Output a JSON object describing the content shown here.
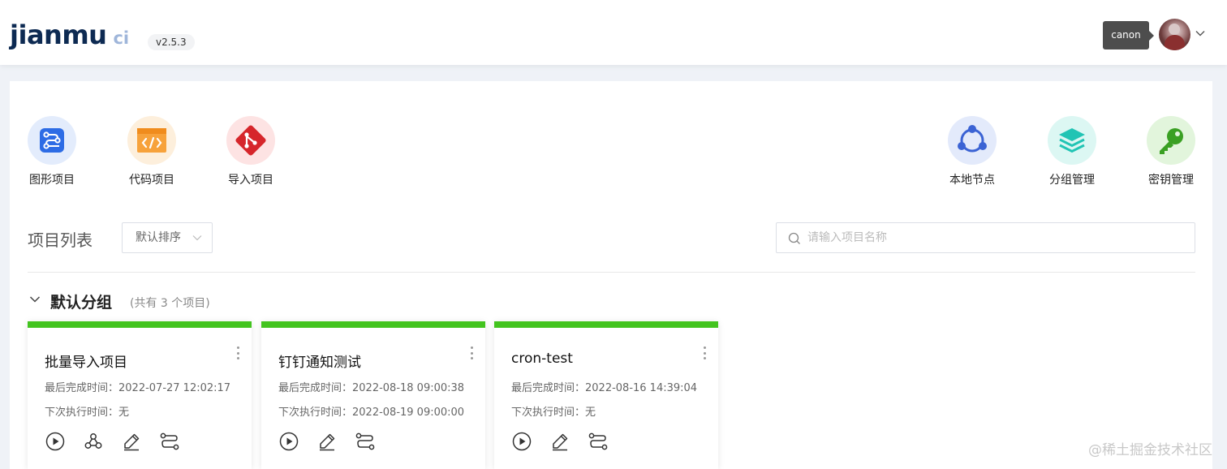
{
  "header": {
    "logo_main": "jianmu",
    "logo_ci": "ci",
    "version": "v2.5.3",
    "user_tooltip": "canon"
  },
  "quick_actions": [
    {
      "label": "图形项目",
      "icon": "graph-project-icon"
    },
    {
      "label": "代码项目",
      "icon": "code-project-icon"
    },
    {
      "label": "导入项目",
      "icon": "git-import-icon"
    },
    {
      "label": "本地节点",
      "icon": "local-node-icon"
    },
    {
      "label": "分组管理",
      "icon": "group-layers-icon"
    },
    {
      "label": "密钥管理",
      "icon": "key-icon"
    }
  ],
  "colors": {
    "accent_green": "#43c41f",
    "graph_blue": "#2d6ce5",
    "code_orange": "#f7a23b",
    "git_red": "#d6262b",
    "node_blue": "#3b63d4",
    "layers_teal": "#21c4b4",
    "key_green": "#3aa023"
  },
  "list": {
    "title": "项目列表",
    "sort_label": "默认排序",
    "search_placeholder": "请输入项目名称"
  },
  "group": {
    "name": "默认分组",
    "count_text": "(共有 3 个项目)"
  },
  "projects": [
    {
      "name": "批量导入项目",
      "last_done": "最后完成时间：2022-07-27 12:02:17",
      "next_run": "下次执行时间：无",
      "actions": [
        "play-icon",
        "webhook-icon",
        "edit-icon",
        "workflow-icon"
      ]
    },
    {
      "name": "钉钉通知测试",
      "last_done": "最后完成时间：2022-08-18 09:00:38",
      "next_run": "下次执行时间：2022-08-19 09:00:00",
      "actions": [
        "play-icon",
        "edit-icon",
        "workflow-icon"
      ]
    },
    {
      "name": "cron-test",
      "last_done": "最后完成时间：2022-08-16 14:39:04",
      "next_run": "下次执行时间：无",
      "actions": [
        "play-icon",
        "edit-icon",
        "workflow-icon"
      ]
    }
  ],
  "watermark": "@稀土掘金技术社区"
}
